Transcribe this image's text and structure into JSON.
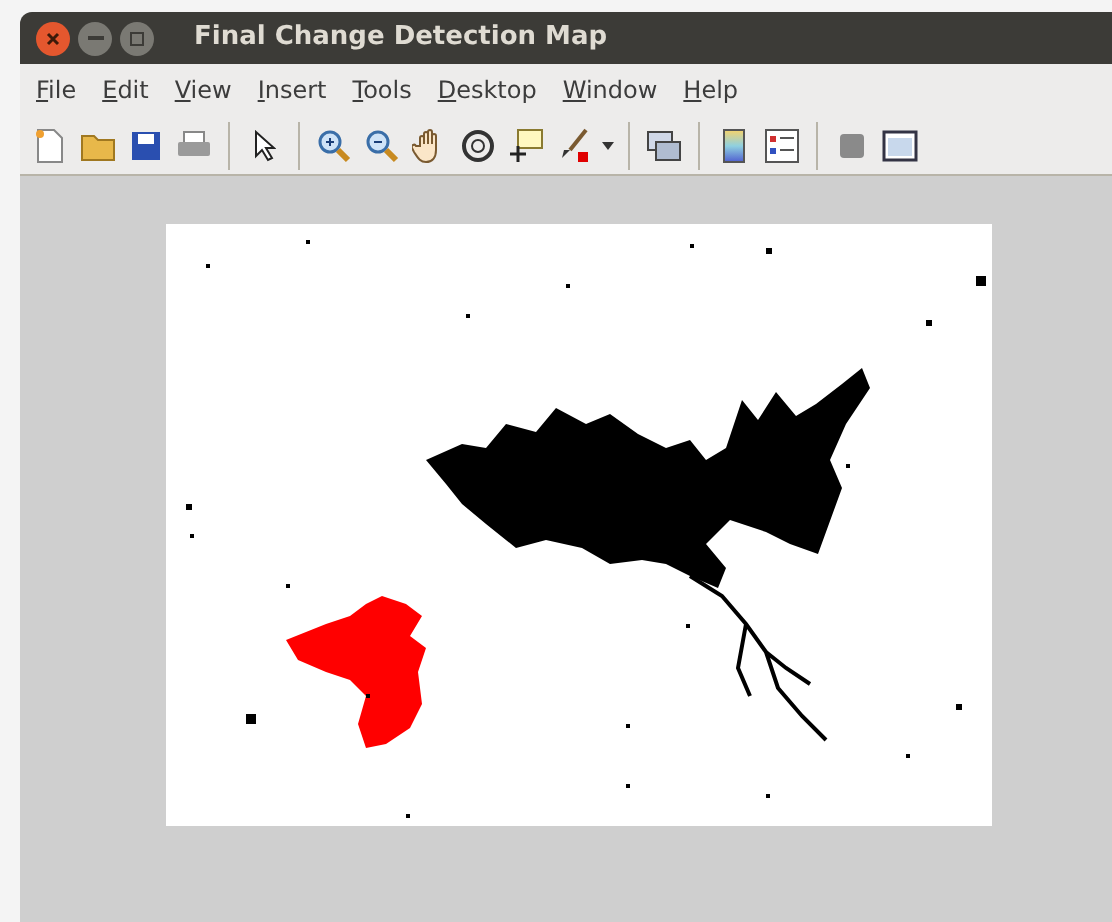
{
  "window": {
    "title": "Final Change Detection Map"
  },
  "menu": [
    "File",
    "Edit",
    "View",
    "Insert",
    "Tools",
    "Desktop",
    "Window",
    "Help"
  ]
}
